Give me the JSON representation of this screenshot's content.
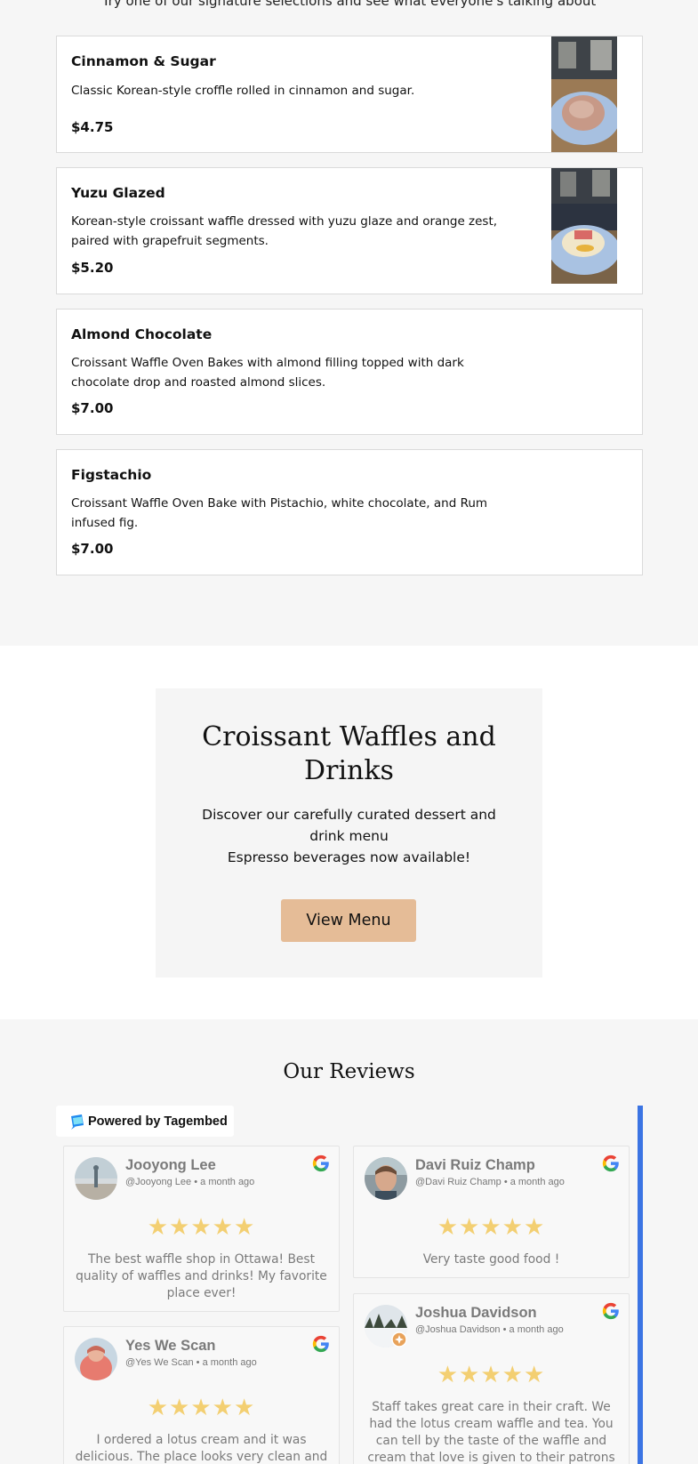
{
  "intro": {
    "text": "Try one of our signature selections and see what everyone's talking about"
  },
  "menu_items": [
    {
      "name": "Cinnamon & Sugar",
      "description": "Classic Korean-style croffle rolled in cinnamon and sugar.",
      "price": "$4.75"
    },
    {
      "name": "Yuzu Glazed",
      "description": "Korean-style croissant waffle dressed with yuzu glaze and orange zest, paired with grapefruit segments.",
      "price": "$5.20"
    },
    {
      "name": "Almond Chocolate",
      "description": "Croissant Waffle Oven Bakes with almond filling topped with dark chocolate drop and roasted almond slices.",
      "price": "$7.00"
    },
    {
      "name": "Figstachio",
      "description": "Croissant Waffle Oven Bake with Pistachio, white chocolate, and Rum infused fig.",
      "price": "$7.00"
    }
  ],
  "feature": {
    "title": "Croissant Waffles and Drinks",
    "line1": "Discover our carefully curated dessert and drink menu",
    "line2": "Espresso beverages now available!",
    "button_label": "View Menu"
  },
  "reviews_section": {
    "title": "Our Reviews",
    "powered_by": "Powered by Tagembed"
  },
  "reviews": [
    {
      "name": "Jooyong Lee",
      "handle": "@Jooyong Lee",
      "time": "• a month ago",
      "stars": "★★★★★",
      "text": "The best waffle shop in Ottawa! Best quality of waffles and drinks! My favorite place ever!"
    },
    {
      "name": "Davi Ruiz Champ",
      "handle": "@Davi Ruiz Champ",
      "time": "• a month ago",
      "stars": "★★★★★",
      "text": "Very taste good food !"
    },
    {
      "name": "Joshua Davidson",
      "handle": "@Joshua Davidson",
      "time": "• a month ago",
      "stars": "★★★★★",
      "text": "Staff takes great care in their craft. We had the lotus cream waffle and tea. You can tell by the taste of the waffle and cream that love is given to their patrons"
    },
    {
      "name": "Yes We Scan",
      "handle": "@Yes We Scan",
      "time": "• a month ago",
      "stars": "★★★★★",
      "text": "I ordered a lotus cream and it was delicious. The place looks very clean and"
    }
  ],
  "colors": {
    "page_bg": "#f6f6f6",
    "button_bg": "#e5bc97",
    "star": "#f3cf72",
    "scroll_rail": "#3b74e3"
  }
}
